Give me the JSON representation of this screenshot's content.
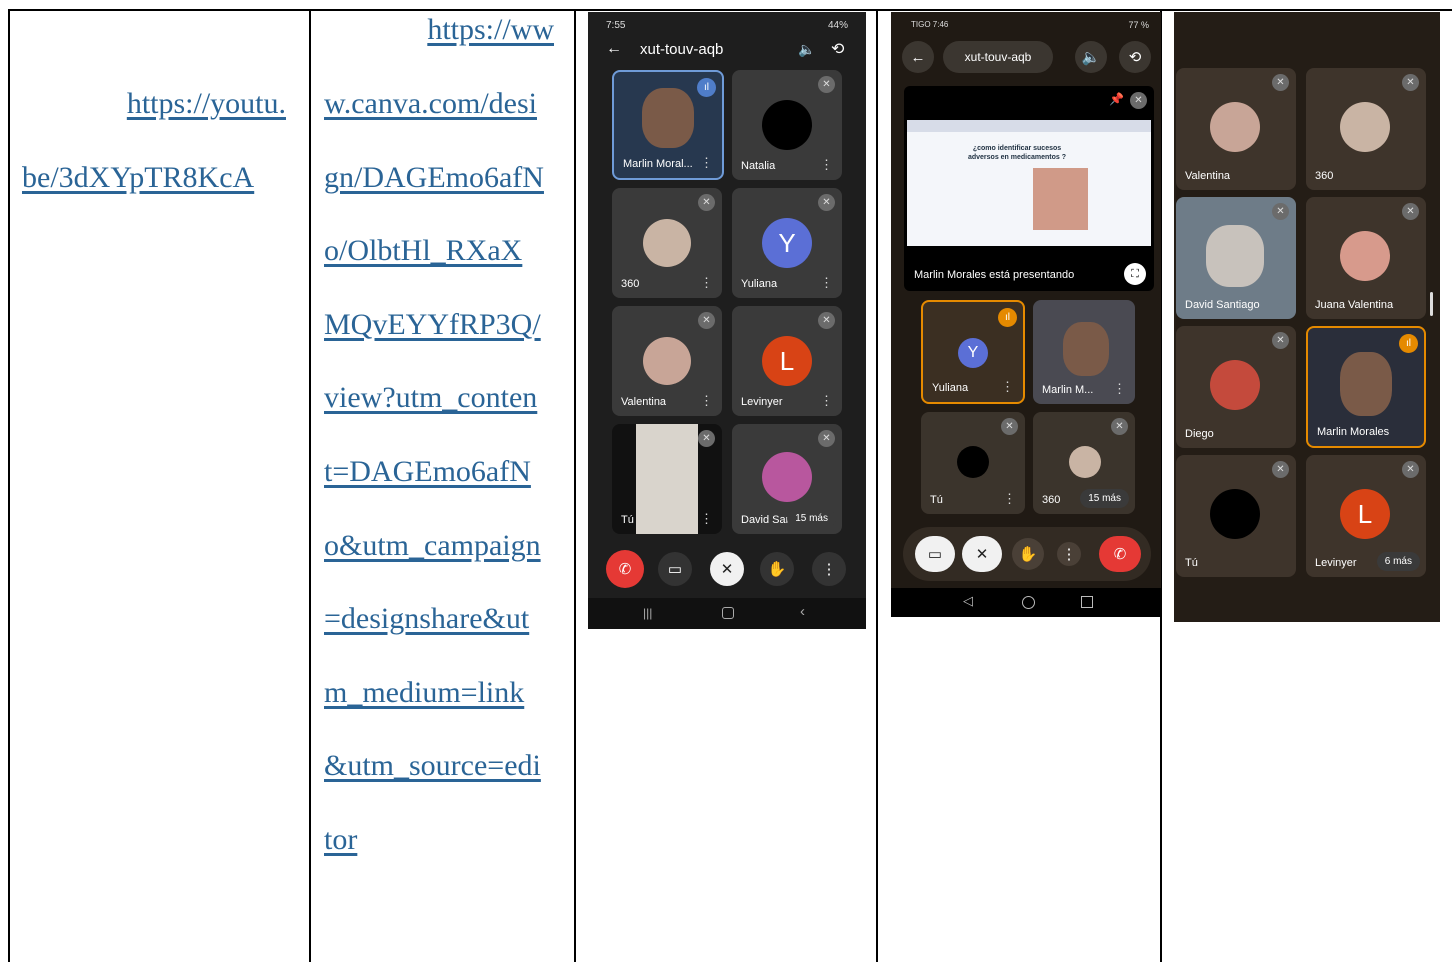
{
  "table": {
    "col1_link": [
      "https://youtu.",
      "be/3dXYpTR8KcA"
    ],
    "col2_link": [
      "https://ww",
      "w.canva.com/desi",
      "gn/DAGEmo6afN",
      "o/OlbtHl_RXaX",
      "MQvEYYfRP3Q/",
      "view?utm_conten",
      "t=DAGEmo6afN",
      "o&utm_campaign",
      "=designshare&ut",
      "m_medium=link",
      "&utm_source=edi",
      "tor"
    ]
  },
  "screen1": {
    "time": "7:55",
    "battery": "44%",
    "meeting_code": "xut-touv-aqb",
    "tiles": [
      "Marlin Moral...",
      "Natalia",
      "360",
      "Yuliana",
      "Valentina",
      "Levinyer",
      "Tú",
      "David San"
    ],
    "letters": {
      "yuliana": "Y",
      "levinyer": "L"
    },
    "more": "15 más"
  },
  "screen2": {
    "carrier": "TIGO 7:46",
    "battery": "77 %",
    "meeting_code": "xut-touv-aqb",
    "slide_title": "¿como identificar  sucesos adversos en medicamentos ?",
    "presenting": "Marlin Morales está presentando",
    "tiles": [
      "Yuliana",
      "Marlin M...",
      "Tú",
      "360"
    ],
    "letters": {
      "yuliana": "Y"
    },
    "more": "15 más"
  },
  "screen3": {
    "tiles": [
      "Valentina",
      "360",
      "David Santiago",
      "Juana Valentina",
      "Diego",
      "Marlin Morales",
      "Tú",
      "Levinyer"
    ],
    "letters": {
      "levinyer": "L"
    },
    "more": "6 más"
  },
  "colors": {
    "link": "#2a6496",
    "end_call": "#e53935",
    "speaking": "#e58a00",
    "yuliana": "#5b6fd6",
    "levinyer": "#d84315"
  }
}
